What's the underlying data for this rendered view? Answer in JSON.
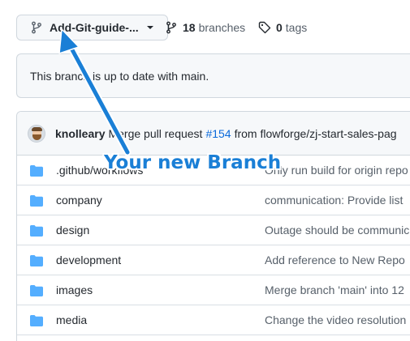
{
  "branch_selector": {
    "name": "Add-Git-guide-...",
    "icon": "git-branch-icon"
  },
  "branches": {
    "count": "18",
    "label": "branches",
    "icon": "git-branch-icon"
  },
  "tags": {
    "count": "0",
    "label": "tags",
    "icon": "tag-icon"
  },
  "status_message": "This branch is up to date with main.",
  "commit": {
    "author": "knolleary",
    "message_prefix": "Merge pull request",
    "pr_number": "#154",
    "message_suffix": "from flowforge/zj-start-sales-pag"
  },
  "files": [
    {
      "name": ".github/workflows",
      "message": "Only run build for origin repo"
    },
    {
      "name": "company",
      "message": "communication: Provide list"
    },
    {
      "name": "design",
      "message": "Outage should be communic"
    },
    {
      "name": "development",
      "message": "Add reference to New Repo"
    },
    {
      "name": "images",
      "message": "Merge branch 'main' into 12"
    },
    {
      "name": "media",
      "message": "Change the video resolution"
    }
  ],
  "annotation": {
    "text": "Your new Branch",
    "color": "#1a7fd6"
  },
  "colors": {
    "link": "#0969da",
    "folder": "#54aeff",
    "border": "#d0d7de"
  }
}
